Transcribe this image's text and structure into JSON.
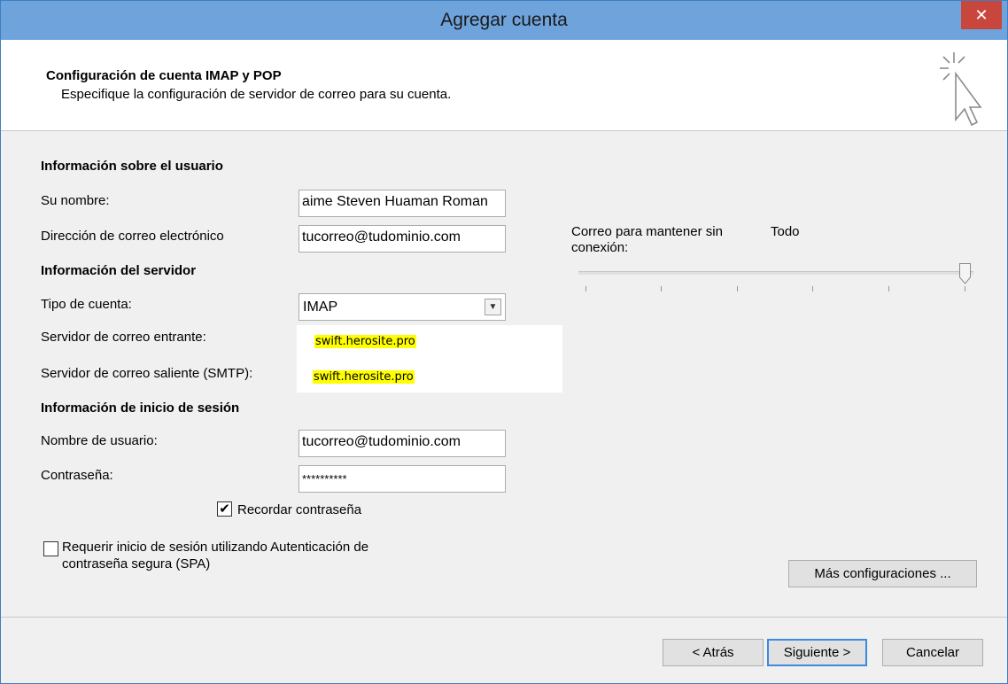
{
  "window": {
    "title": "Agregar cuenta",
    "close_glyph": "✕"
  },
  "header": {
    "title": "Configuración de cuenta IMAP y POP",
    "subtitle": "Especifique la configuración de servidor de correo para su cuenta.",
    "icon": "cursor-sparkle-icon"
  },
  "user_info": {
    "section": "Información sobre el usuario",
    "name_label": "Su nombre:",
    "name_value": "aime Steven Huaman Roman",
    "email_label": "Dirección de correo electrónico",
    "email_value": "tucorreo@tudominio.com"
  },
  "server_info": {
    "section": "Información del servidor",
    "account_type_label": "Tipo de cuenta:",
    "account_type_value": "IMAP",
    "incoming_label": "Servidor de correo entrante:",
    "incoming_value": "swift.herosite.pro",
    "outgoing_label": "Servidor de correo saliente (SMTP):",
    "outgoing_value": "swift.herosite.pro"
  },
  "login_info": {
    "section": "Información de inicio de sesión",
    "username_label": "Nombre de usuario:",
    "username_value": "tucorreo@tudominio.com",
    "password_label": "Contraseña:",
    "password_value": "**********",
    "remember_label": "Recordar contraseña",
    "remember_checked": true,
    "spa_label_line1": "Requerir inicio de sesión utilizando Autenticación de",
    "spa_label_line2": "contraseña segura (SPA)",
    "spa_checked": false
  },
  "offline": {
    "label_line1": "Correo para mantener sin",
    "label_line2": "conexión:",
    "value": "Todo",
    "slider_level": 1.0
  },
  "buttons": {
    "more_settings": "Más configuraciones ...",
    "back": "< Atrás",
    "next": "Siguiente >",
    "cancel": "Cancelar"
  },
  "colors": {
    "titlebar": "#6fa3dc",
    "close": "#c9463d",
    "highlight": "#ffff00",
    "default_button_border": "#3c8ae0"
  }
}
